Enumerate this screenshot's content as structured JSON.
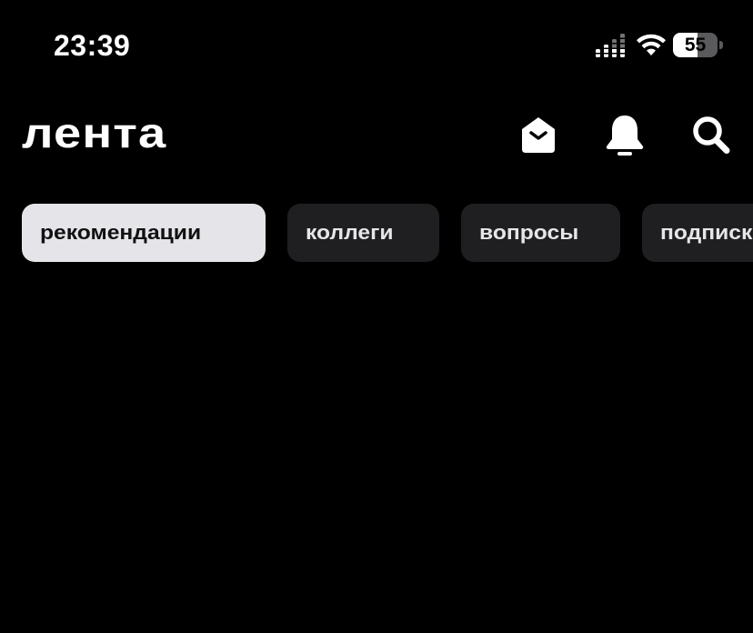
{
  "status_bar": {
    "time": "23:39",
    "battery_level": "55",
    "battery_fraction": 0.55,
    "icons": [
      "signal-icon",
      "wifi-icon",
      "battery-icon"
    ]
  },
  "header": {
    "title": "лента",
    "icons": [
      "mail-icon",
      "bell-icon",
      "search-icon"
    ]
  },
  "tabs": [
    {
      "label": "рекомендации",
      "active": true
    },
    {
      "label": "коллеги",
      "active": false
    },
    {
      "label": "вопросы",
      "active": false
    },
    {
      "label": "подписки",
      "active": false
    }
  ],
  "colors": {
    "background": "#000000",
    "tab_active_bg": "#e4e4e9",
    "tab_inactive_bg": "#1f1f21",
    "text_primary": "#ffffff"
  }
}
